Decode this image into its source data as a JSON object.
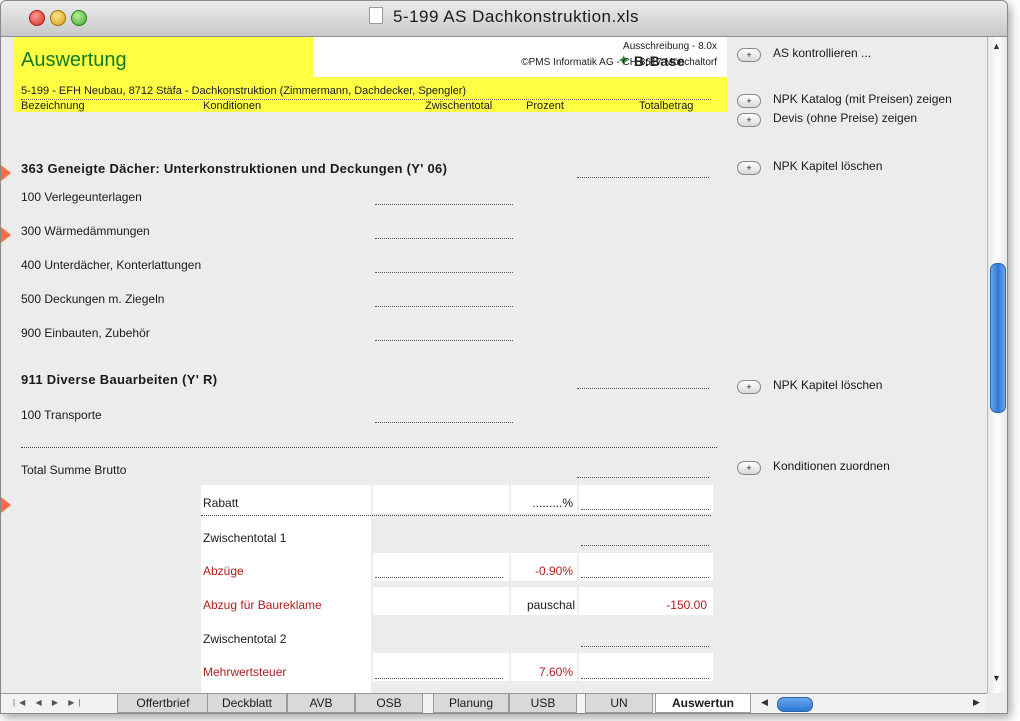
{
  "window": {
    "title": "5-199 AS Dachkonstruktion.xls"
  },
  "banner": {
    "title": "Auswertung",
    "logo": "B:Base",
    "version": "Ausschreibung - 8.0x",
    "company": "©PMS Informatik AG - CH 8617 Mönchaltorf",
    "project": "5-199 - EFH Neubau, 8712 Stäfa  - Dachkonstruktion (Zimmermann, Dachdecker, Spengler)"
  },
  "columns": {
    "bezeichnung": "Bezeichnung",
    "konditionen": "Konditionen",
    "zwischentotal": "Zwischentotal",
    "prozent": "Prozent",
    "totalbetrag": "Totalbetrag"
  },
  "sections": {
    "s363": {
      "title": "363 Geneigte Dächer: Unterkonstruktionen und Deckungen (Y' 06)",
      "items": [
        "100 Verlegeunterlagen",
        "300 Wärmedämmungen",
        "400 Unterdächer, Konterlattungen",
        "500 Deckungen m. Ziegeln",
        "900 Einbauten, Zubehör"
      ]
    },
    "s911": {
      "title": "911 Diverse Bauarbeiten (Y' R)",
      "items": [
        "100 Transporte"
      ]
    }
  },
  "totals": {
    "total_brutto": "Total Summe Brutto",
    "rabatt": "Rabatt",
    "rabatt_pct": ".........%",
    "zwischentotal1": "Zwischentotal 1",
    "abzuege": "Abzüge",
    "abzuege_pct": "-0.90%",
    "abzug_baureklame": "Abzug für Baureklame",
    "baureklame_type": "pauschal",
    "baureklame_value": "-150.00",
    "zwischentotal2": "Zwischentotal 2",
    "mwst": "Mehrwertsteuer",
    "mwst_pct": "7.60%"
  },
  "sidebar": {
    "btn_plus": "+",
    "as_kontrollieren": "AS kontrollieren ...",
    "npk_katalog": "NPK Katalog (mit Preisen) zeigen",
    "devis": "Devis (ohne Preise) zeigen",
    "npk_loeschen": "NPK Kapitel löschen",
    "konditionen": "Konditionen zuordnen"
  },
  "tabs": [
    "Offertbrief",
    "Deckblatt",
    "AVB",
    "OSB",
    "Planung",
    "USB",
    "UN",
    "Auswertun"
  ],
  "colors": {
    "banner": "#ffff44",
    "title_green": "#117a1b",
    "red_text": "#b31d1d",
    "marker": "#ff6b4a"
  }
}
